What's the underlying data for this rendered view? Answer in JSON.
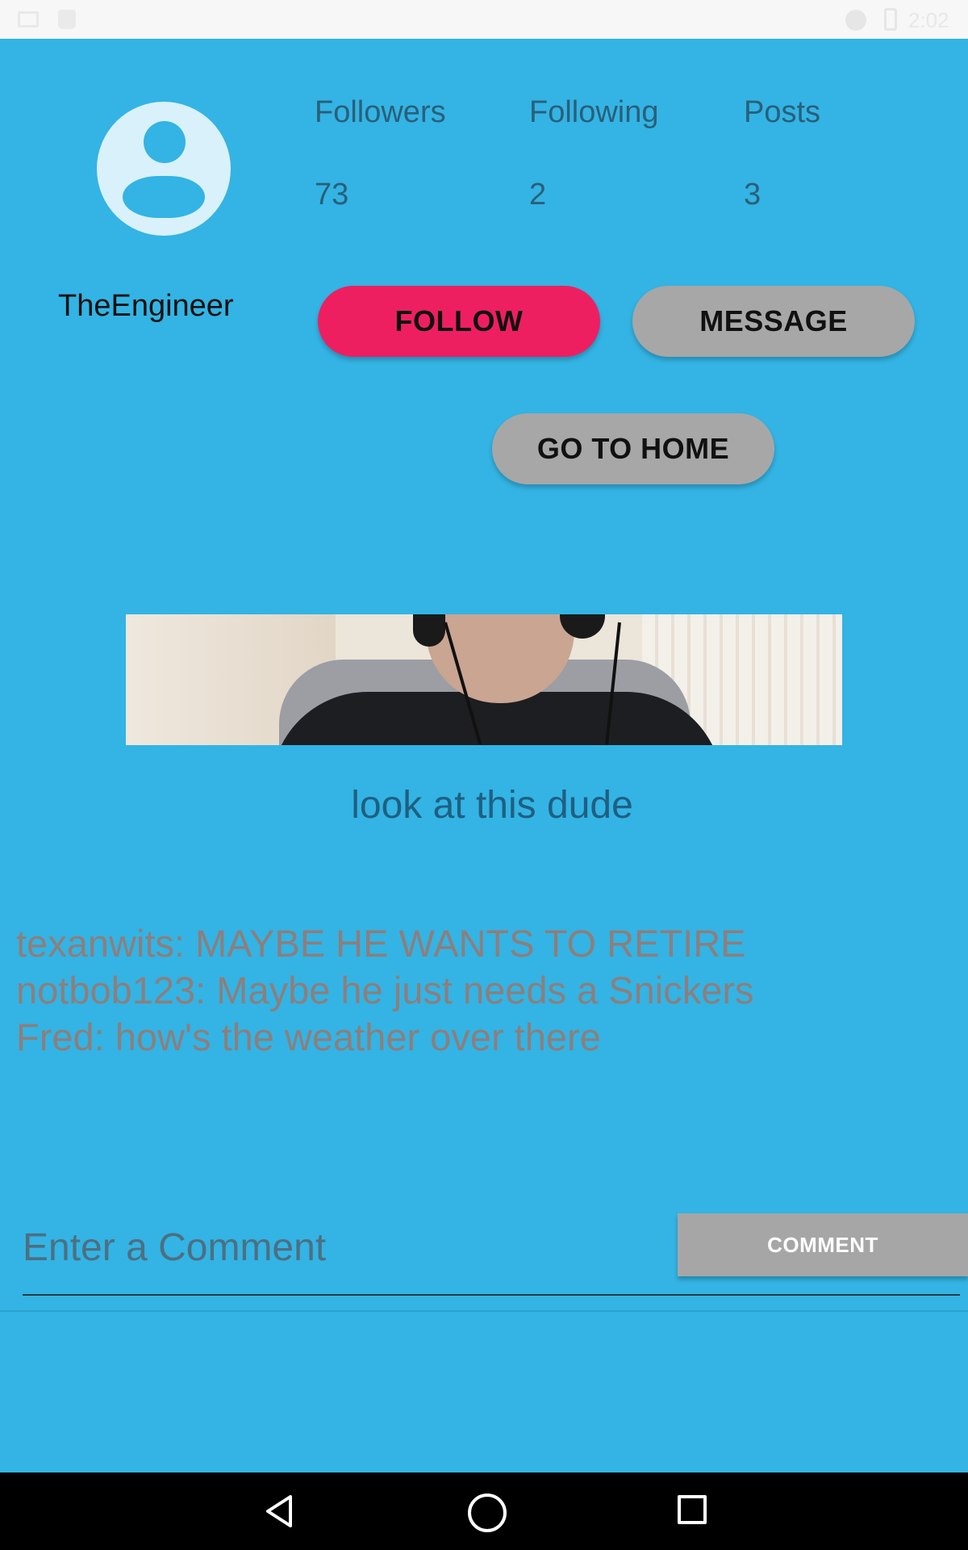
{
  "status_bar": {
    "time": "2:02",
    "left_icons": [
      "image-icon",
      "android-icon"
    ],
    "right_icons": [
      "minus-circle-icon",
      "battery-icon"
    ]
  },
  "profile": {
    "username": "TheEngineer",
    "stats": [
      {
        "label": "Followers",
        "value": "73"
      },
      {
        "label": "Following",
        "value": "2"
      },
      {
        "label": "Posts",
        "value": "3"
      }
    ]
  },
  "actions": {
    "follow_label": "FOLLOW",
    "message_label": "MESSAGE",
    "home_label": "GO TO HOME"
  },
  "post": {
    "caption": "look at this dude",
    "comments": [
      "texanwits: MAYBE HE WANTS TO RETIRE",
      "notbob123: Maybe he just needs a Snickers",
      "Fred: how's the weather over there"
    ]
  },
  "comment_box": {
    "placeholder": "Enter a Comment",
    "value": "",
    "button_label": "COMMENT"
  },
  "nav_bar": {
    "icons": [
      "back-icon",
      "home-circle-icon",
      "recents-icon"
    ]
  },
  "colors": {
    "background": "#33b4e4",
    "follow_button": "#ee1f61",
    "secondary_button": "#a7a7a7",
    "comment_text": "#8e7e7c",
    "caption_text": "#1f5f82"
  }
}
